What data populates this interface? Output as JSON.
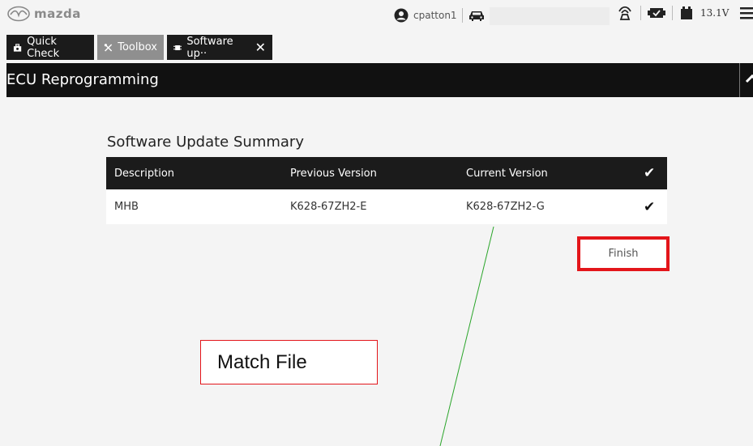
{
  "topbar": {
    "brand": "mazda",
    "username": "cpatton1",
    "voltage": "13.1V",
    "icons": [
      "mazda-logo-icon",
      "user-icon",
      "car-icon",
      "connection-icon",
      "vci-icon",
      "battery-icon",
      "menu-icon"
    ]
  },
  "tabs": [
    {
      "label": "Quick Check",
      "icon": "toolbox-case-icon"
    },
    {
      "label": "Toolbox",
      "icon": "tools-icon"
    },
    {
      "label": "Software up··",
      "icon": "chip-icon",
      "close": "✕"
    }
  ],
  "header": {
    "title": "ECU Reprogramming"
  },
  "summary": {
    "title": "Software Update Summary",
    "columns": [
      "Description",
      "Previous Version",
      "Current Version",
      "✔"
    ],
    "rows": [
      {
        "description": "MHB",
        "previous": "K628-67ZH2-E",
        "current": "K628-67ZH2-G",
        "status": "✔"
      }
    ]
  },
  "finish_label": "Finish",
  "annotation": {
    "label": "Match File"
  },
  "colors": {
    "highlight": "#e3151a",
    "leader_line": "#2aa52a",
    "dark": "#1b1b1b"
  }
}
